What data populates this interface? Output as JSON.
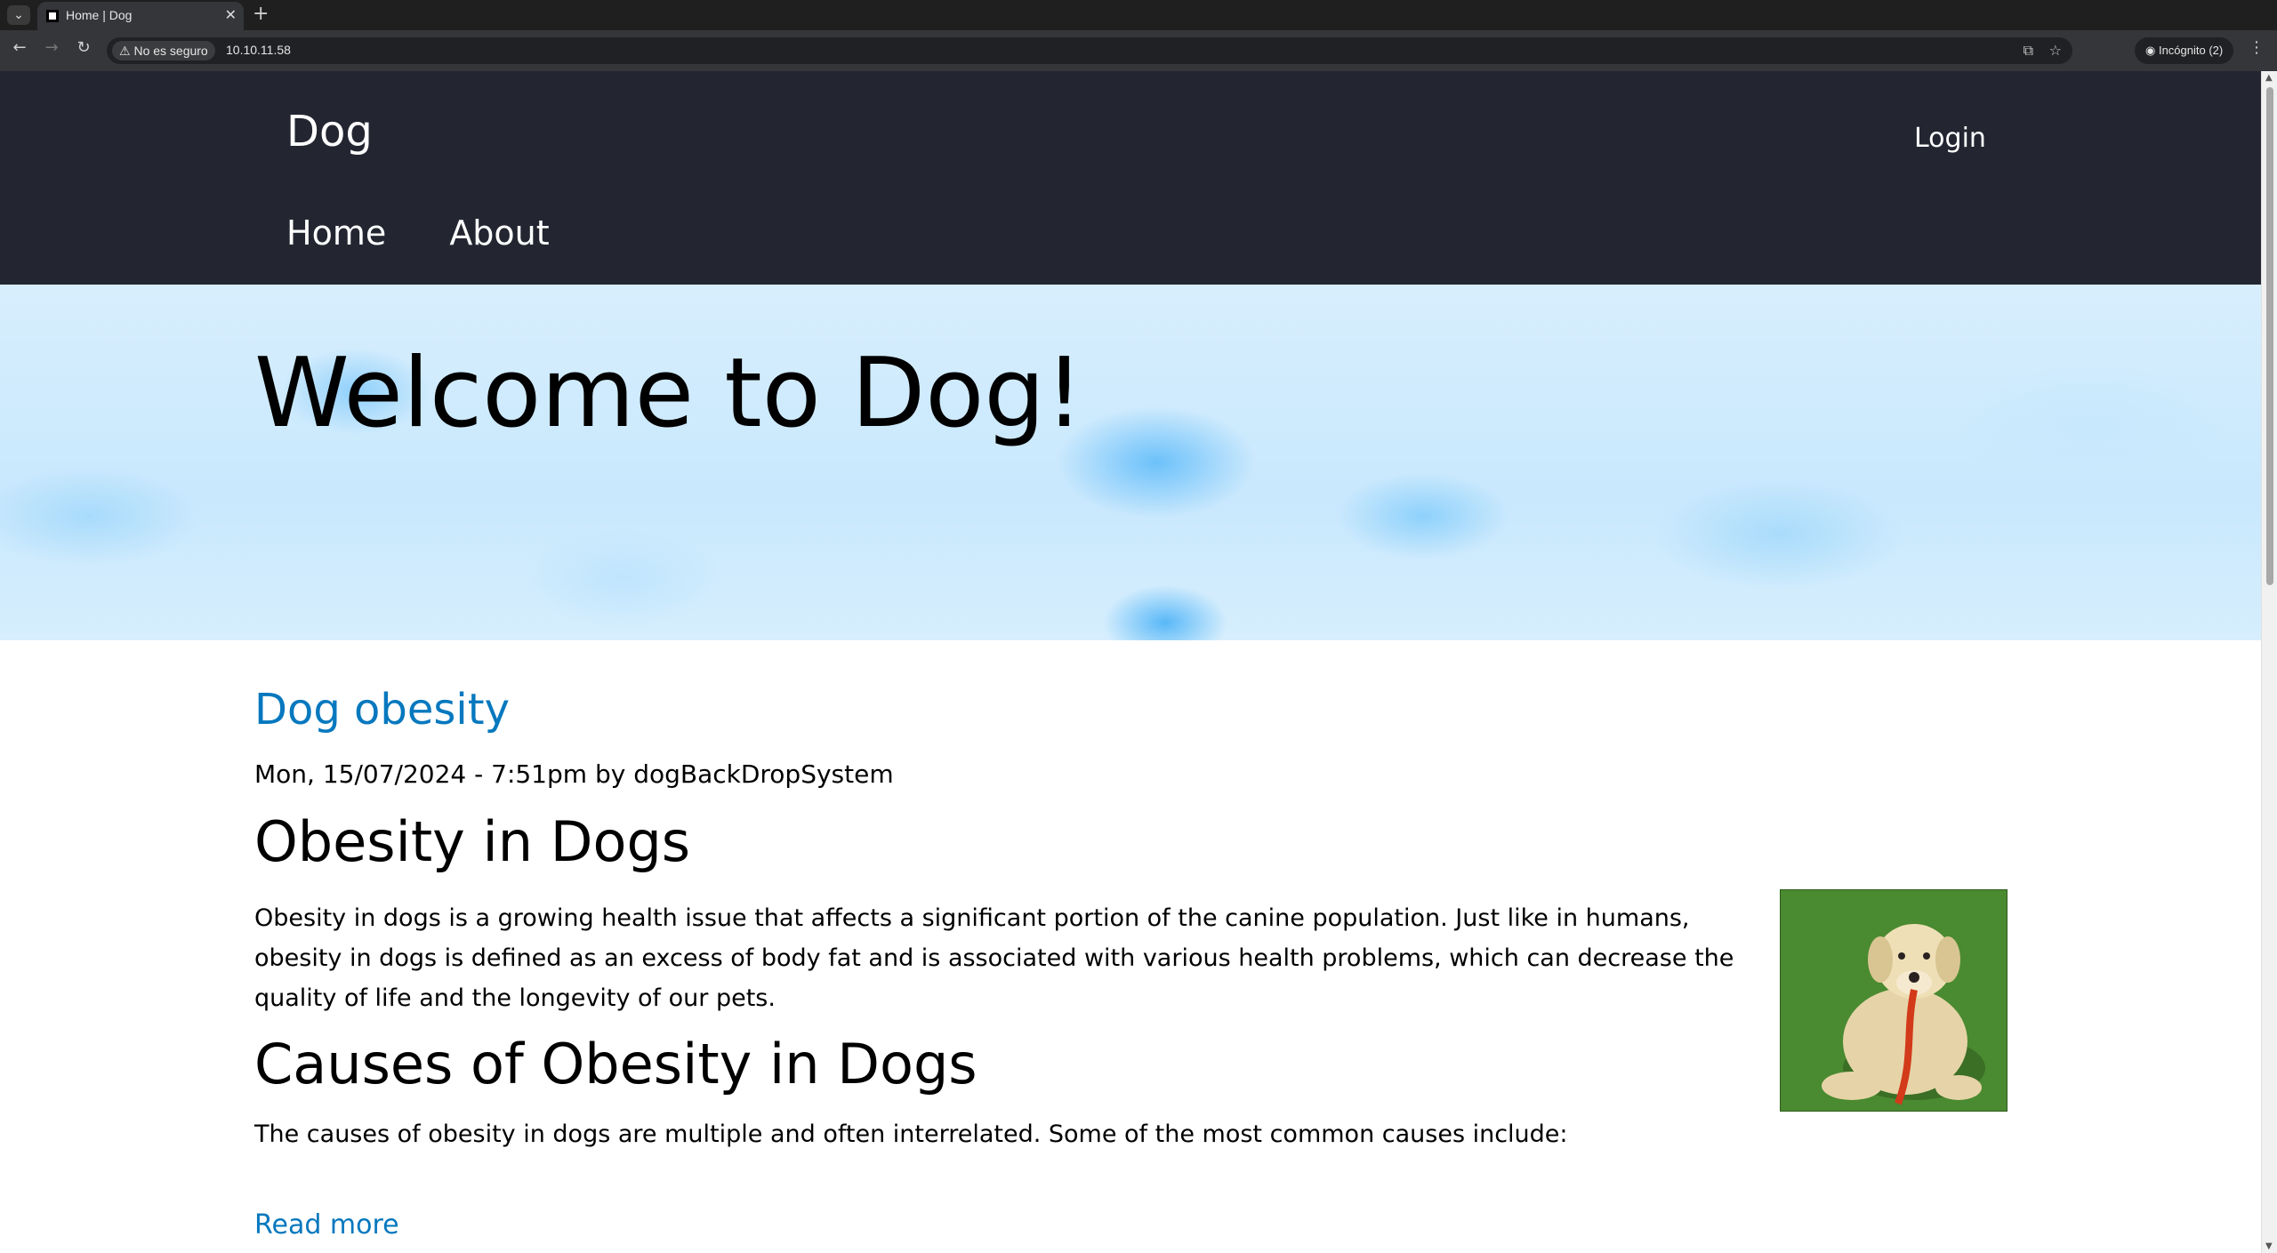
{
  "browser": {
    "tab_title": "Home | Dog",
    "new_tab_symbol": "+",
    "security_label": "No es seguro",
    "url": "10.10.11.58",
    "incognito_label": "Incógnito (2)"
  },
  "site": {
    "name": "Dog",
    "login_label": "Login",
    "nav": {
      "home": "Home",
      "about": "About"
    }
  },
  "hero": {
    "title": "Welcome to Dog!"
  },
  "article": {
    "title": "Dog obesity",
    "meta": "Mon, 15/07/2024 - 7:51pm by dogBackDropSystem",
    "heading_1": "Obesity in Dogs",
    "paragraph_1": "Obesity in dogs is a growing health issue that affects a significant portion of the canine population. Just like in humans, obesity in dogs is defined as an excess of body fat and is associated with various health problems, which can decrease the quality of life and the longevity of our pets.",
    "heading_2": "Causes of Obesity in Dogs",
    "paragraph_2": "The causes of obesity in dogs are multiple and often interrelated. Some of the most common causes include:",
    "read_more": "Read more"
  },
  "colors": {
    "header_bg": "#232631",
    "link": "#0678be",
    "hero_bg": "#c9e8fd"
  }
}
